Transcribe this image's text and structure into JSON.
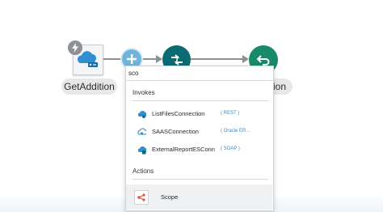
{
  "canvas": {
    "trigger_label": "GetAddition",
    "return_label_fragment": "tion"
  },
  "popup": {
    "search_value": "sco",
    "invokes_title": "Invokes",
    "invokes": [
      {
        "name": "ListFilesConnection",
        "tag": "( REST )",
        "icon": "rest-connection-icon"
      },
      {
        "name": "SAASConnection",
        "tag": "( Oracle ER...",
        "icon": "saas-connection-icon"
      },
      {
        "name": "ExternalReportESConn",
        "tag": "( SOAP )",
        "icon": "soap-connection-icon"
      }
    ],
    "actions_title": "Actions",
    "actions": [
      {
        "name": "Scope",
        "icon": "scope-icon"
      }
    ]
  },
  "colors": {
    "add_button": "#6fb4dc",
    "invoke_node": "#0b6b74",
    "return_node": "#178a6a",
    "scope_icon": "#e0573b",
    "tag_text": "#4a86b8"
  }
}
